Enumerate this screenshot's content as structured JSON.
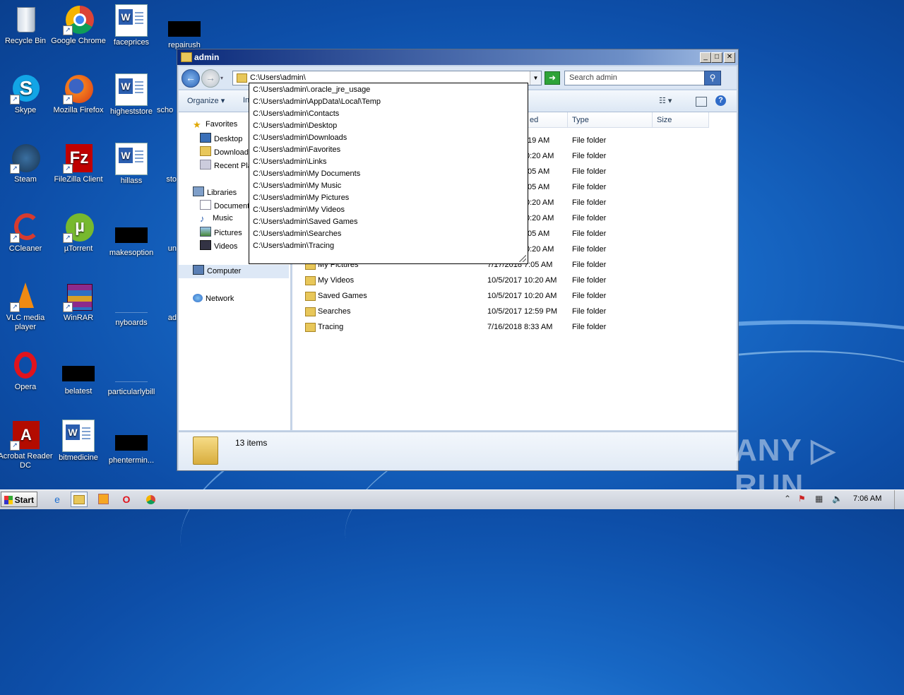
{
  "desktop": {
    "icons": [
      {
        "label": "Recycle Bin"
      },
      {
        "label": "Google Chrome"
      },
      {
        "label": "faceprices"
      },
      {
        "label": "repairush"
      },
      {
        "label": "Skype"
      },
      {
        "label": "Mozilla Firefox"
      },
      {
        "label": "higheststore"
      },
      {
        "label": "scho"
      },
      {
        "label": "Steam"
      },
      {
        "label": "FileZilla Client"
      },
      {
        "label": "hillass"
      },
      {
        "label": "sto"
      },
      {
        "label": "CCleaner"
      },
      {
        "label": "µTorrent"
      },
      {
        "label": "makesoption"
      },
      {
        "label": "un"
      },
      {
        "label": "VLC media player"
      },
      {
        "label": "WinRAR"
      },
      {
        "label": "nyboards"
      },
      {
        "label": "ad"
      },
      {
        "label": "Opera"
      },
      {
        "label": "belatest"
      },
      {
        "label": "particularlybill"
      },
      {
        "label": "Acrobat Reader DC"
      },
      {
        "label": "bitmedicine"
      },
      {
        "label": "phentermin..."
      }
    ]
  },
  "window": {
    "title": "admin",
    "controls": {
      "minimize": "_",
      "maximize": "□",
      "close": "✕"
    },
    "address": {
      "value": "C:\\Users\\admin\\"
    },
    "search": {
      "placeholder": "Search admin"
    },
    "toolbar": {
      "organize": "Organize",
      "include_partial": "In"
    },
    "autocomplete": [
      "C:\\Users\\admin\\.oracle_jre_usage",
      "C:\\Users\\admin\\AppData\\Local\\Temp",
      "C:\\Users\\admin\\Contacts",
      "C:\\Users\\admin\\Desktop",
      "C:\\Users\\admin\\Downloads",
      "C:\\Users\\admin\\Favorites",
      "C:\\Users\\admin\\Links",
      "C:\\Users\\admin\\My Documents",
      "C:\\Users\\admin\\My Music",
      "C:\\Users\\admin\\My Pictures",
      "C:\\Users\\admin\\My Videos",
      "C:\\Users\\admin\\Saved Games",
      "C:\\Users\\admin\\Searches",
      "C:\\Users\\admin\\Tracing"
    ],
    "nav": {
      "favorites": "Favorites",
      "desktop": "Desktop",
      "downloads": "Downloads",
      "recent": "Recent Pla",
      "libraries": "Libraries",
      "documents": "Documents",
      "music": "Music",
      "pictures": "Pictures",
      "videos": "Videos",
      "computer": "Computer",
      "network": "Network"
    },
    "columns": {
      "date_partial": "ed",
      "type": "Type",
      "size": "Size"
    },
    "partial_rows": [
      {
        "date": ":19 AM",
        "type": "File folder"
      },
      {
        "date": "0:20 AM",
        "type": "File folder"
      },
      {
        "date": ":05 AM",
        "type": "File folder"
      },
      {
        "date": ":05 AM",
        "type": "File folder"
      },
      {
        "date": "0:20 AM",
        "type": "File folder"
      },
      {
        "date": "0:20 AM",
        "type": "File folder"
      },
      {
        "date": ":05 AM",
        "type": "File folder"
      },
      {
        "date": "0:20 AM",
        "type": "File folder"
      }
    ],
    "rows": [
      {
        "name": "My Pictures",
        "date": "7/17/2018 7:05 AM",
        "type": "File folder"
      },
      {
        "name": "My Videos",
        "date": "10/5/2017 10:20 AM",
        "type": "File folder"
      },
      {
        "name": "Saved Games",
        "date": "10/5/2017 10:20 AM",
        "type": "File folder"
      },
      {
        "name": "Searches",
        "date": "10/5/2017 12:59 PM",
        "type": "File folder"
      },
      {
        "name": "Tracing",
        "date": "7/16/2018 8:33 AM",
        "type": "File folder"
      }
    ],
    "status": {
      "item_count": "13 items"
    }
  },
  "taskbar": {
    "start": "Start",
    "clock": "7:06 AM"
  },
  "watermark": "ANY ▷ RUN",
  "colors": {
    "accent": "#1767c4",
    "titlebar": "#0b2a7a",
    "go": "#2ea338"
  }
}
